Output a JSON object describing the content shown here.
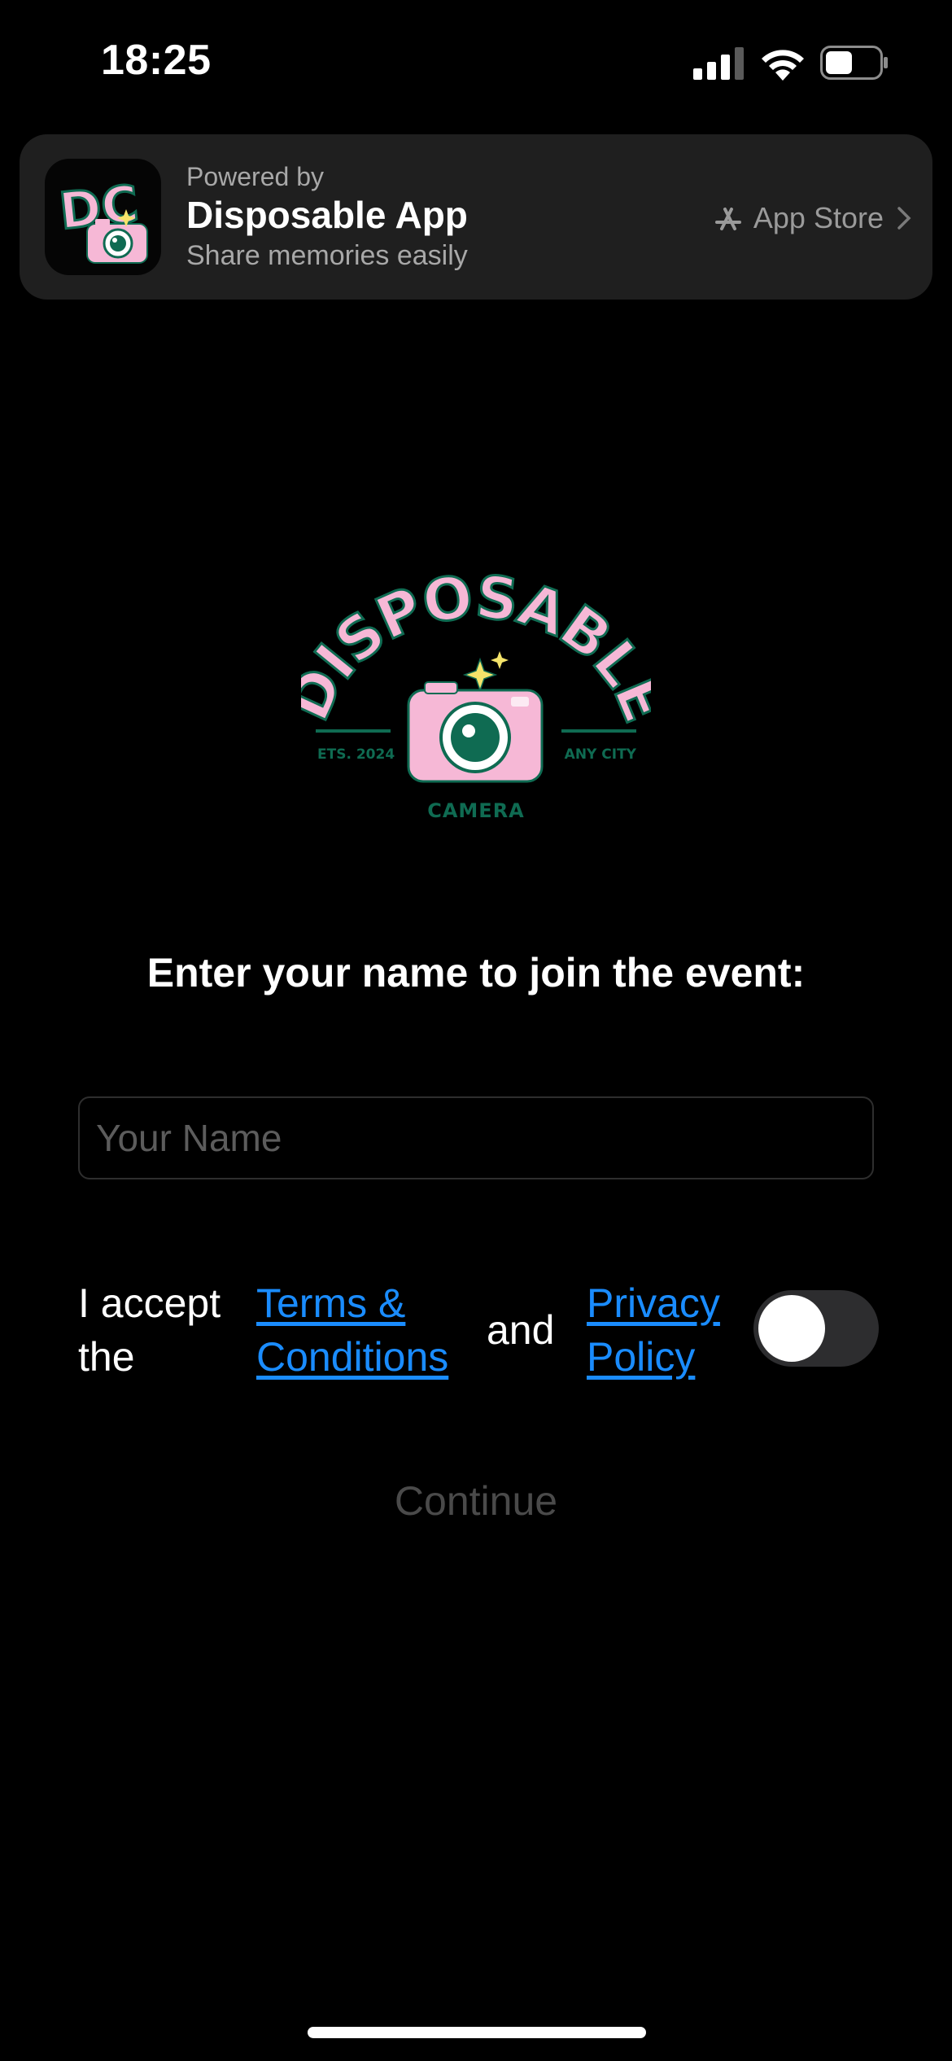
{
  "status_bar": {
    "time": "18:25",
    "icons": [
      "signal-icon",
      "wifi-icon",
      "battery-icon"
    ]
  },
  "banner": {
    "powered_by": "Powered by",
    "title": "Disposable App",
    "subtitle": "Share memories easily",
    "store_label": "App Store",
    "store_icon": "app-store-icon",
    "icon_letters": "DC"
  },
  "logo": {
    "top_text": "DISPOSABLE",
    "left_tag": "ETS. 2024",
    "right_tag": "ANY CITY",
    "bottom_text": "CAMERA",
    "colors": {
      "pink": "#f6b8d6",
      "green": "#0f6b52",
      "yellow": "#f4e36a"
    }
  },
  "form": {
    "heading": "Enter your name to join the event:",
    "name_placeholder": "Your Name",
    "name_value": "",
    "accept_text": "I accept the",
    "terms_link": "Terms & Conditions",
    "and_text": "and",
    "privacy_link": "Privacy Policy",
    "toggle_on": false,
    "continue_label": "Continue"
  },
  "colors": {
    "background": "#000000",
    "link": "#1a8cff",
    "disabled_text": "#4a4a4a",
    "banner_bg": "#1f1f1f"
  }
}
